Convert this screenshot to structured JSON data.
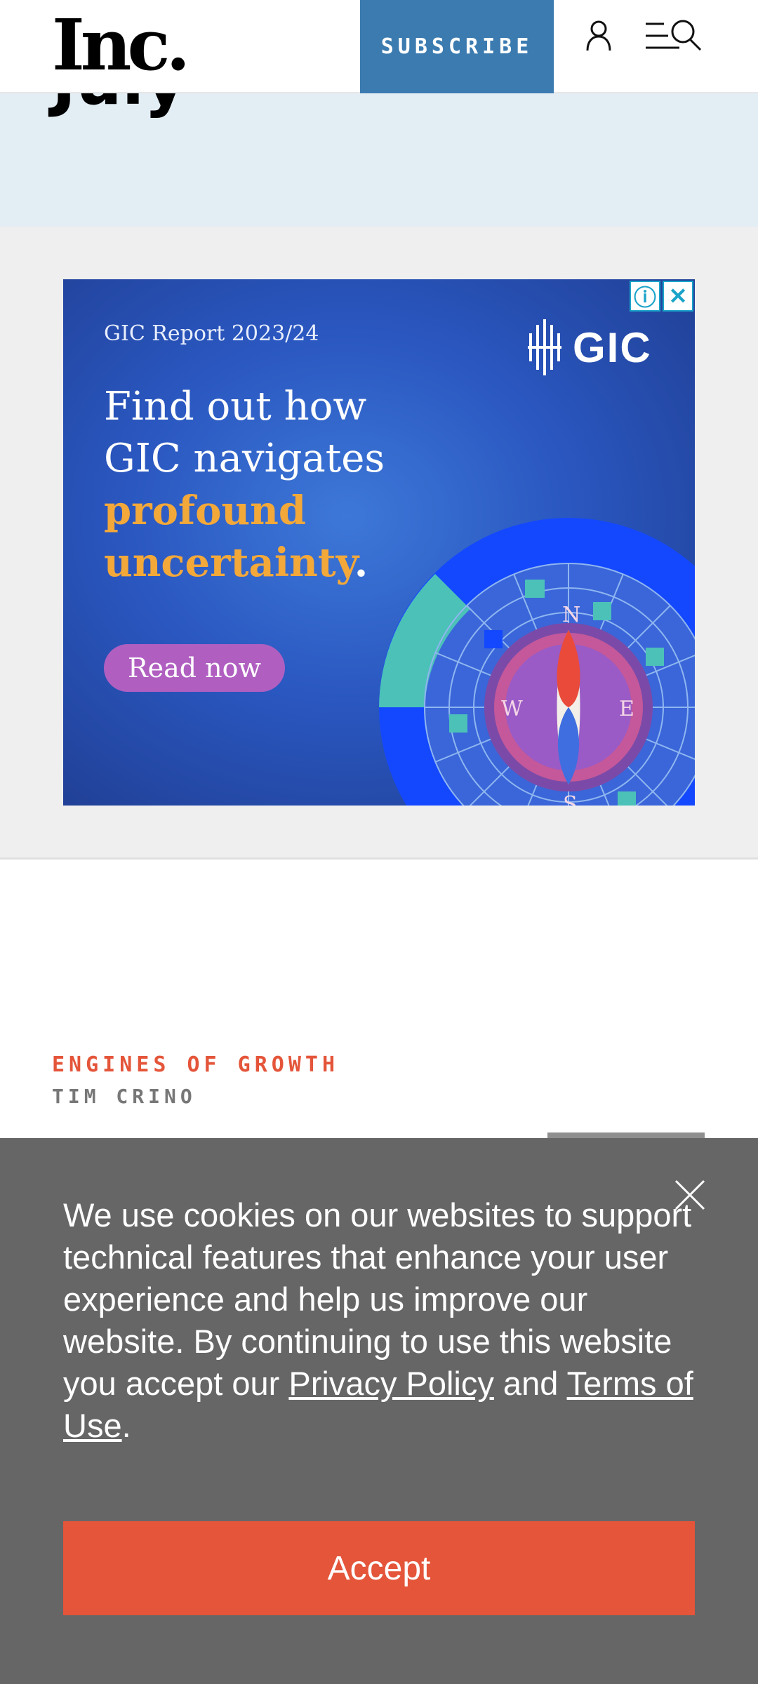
{
  "header": {
    "logo": "Inc.",
    "subscribe_label": "SUBSCRIBE",
    "accent_color": "#3b7bb0",
    "icons": [
      "user-icon",
      "menu-search-icon"
    ]
  },
  "hero": {
    "title_fragment": "July"
  },
  "ad": {
    "info_icon": "ⓘ",
    "close_icon": "✕",
    "report_label": "GIC Report 2023/24",
    "brand": "GIC",
    "headline_1": "Find out how",
    "headline_2": "GIC navigates",
    "headline_3": "profound",
    "headline_4": "uncertainty",
    "headline_period": ".",
    "cta_label": "Read now",
    "compass": {
      "n": "N",
      "s": "S",
      "e": "E",
      "w": "W"
    }
  },
  "article": {
    "kicker": "ENGINES OF GROWTH",
    "author": "TIM CRINO"
  },
  "cookie": {
    "text_before": "We use cookies on our websites to support technical features that enhance your user experience and help us improve our website. By continuing to use this website you accept our ",
    "privacy_link": "Privacy Policy",
    "text_and": " and ",
    "terms_link": "Terms of Use",
    "text_end": ".",
    "accept_label": "Accept",
    "accept_color": "#e4553a"
  }
}
